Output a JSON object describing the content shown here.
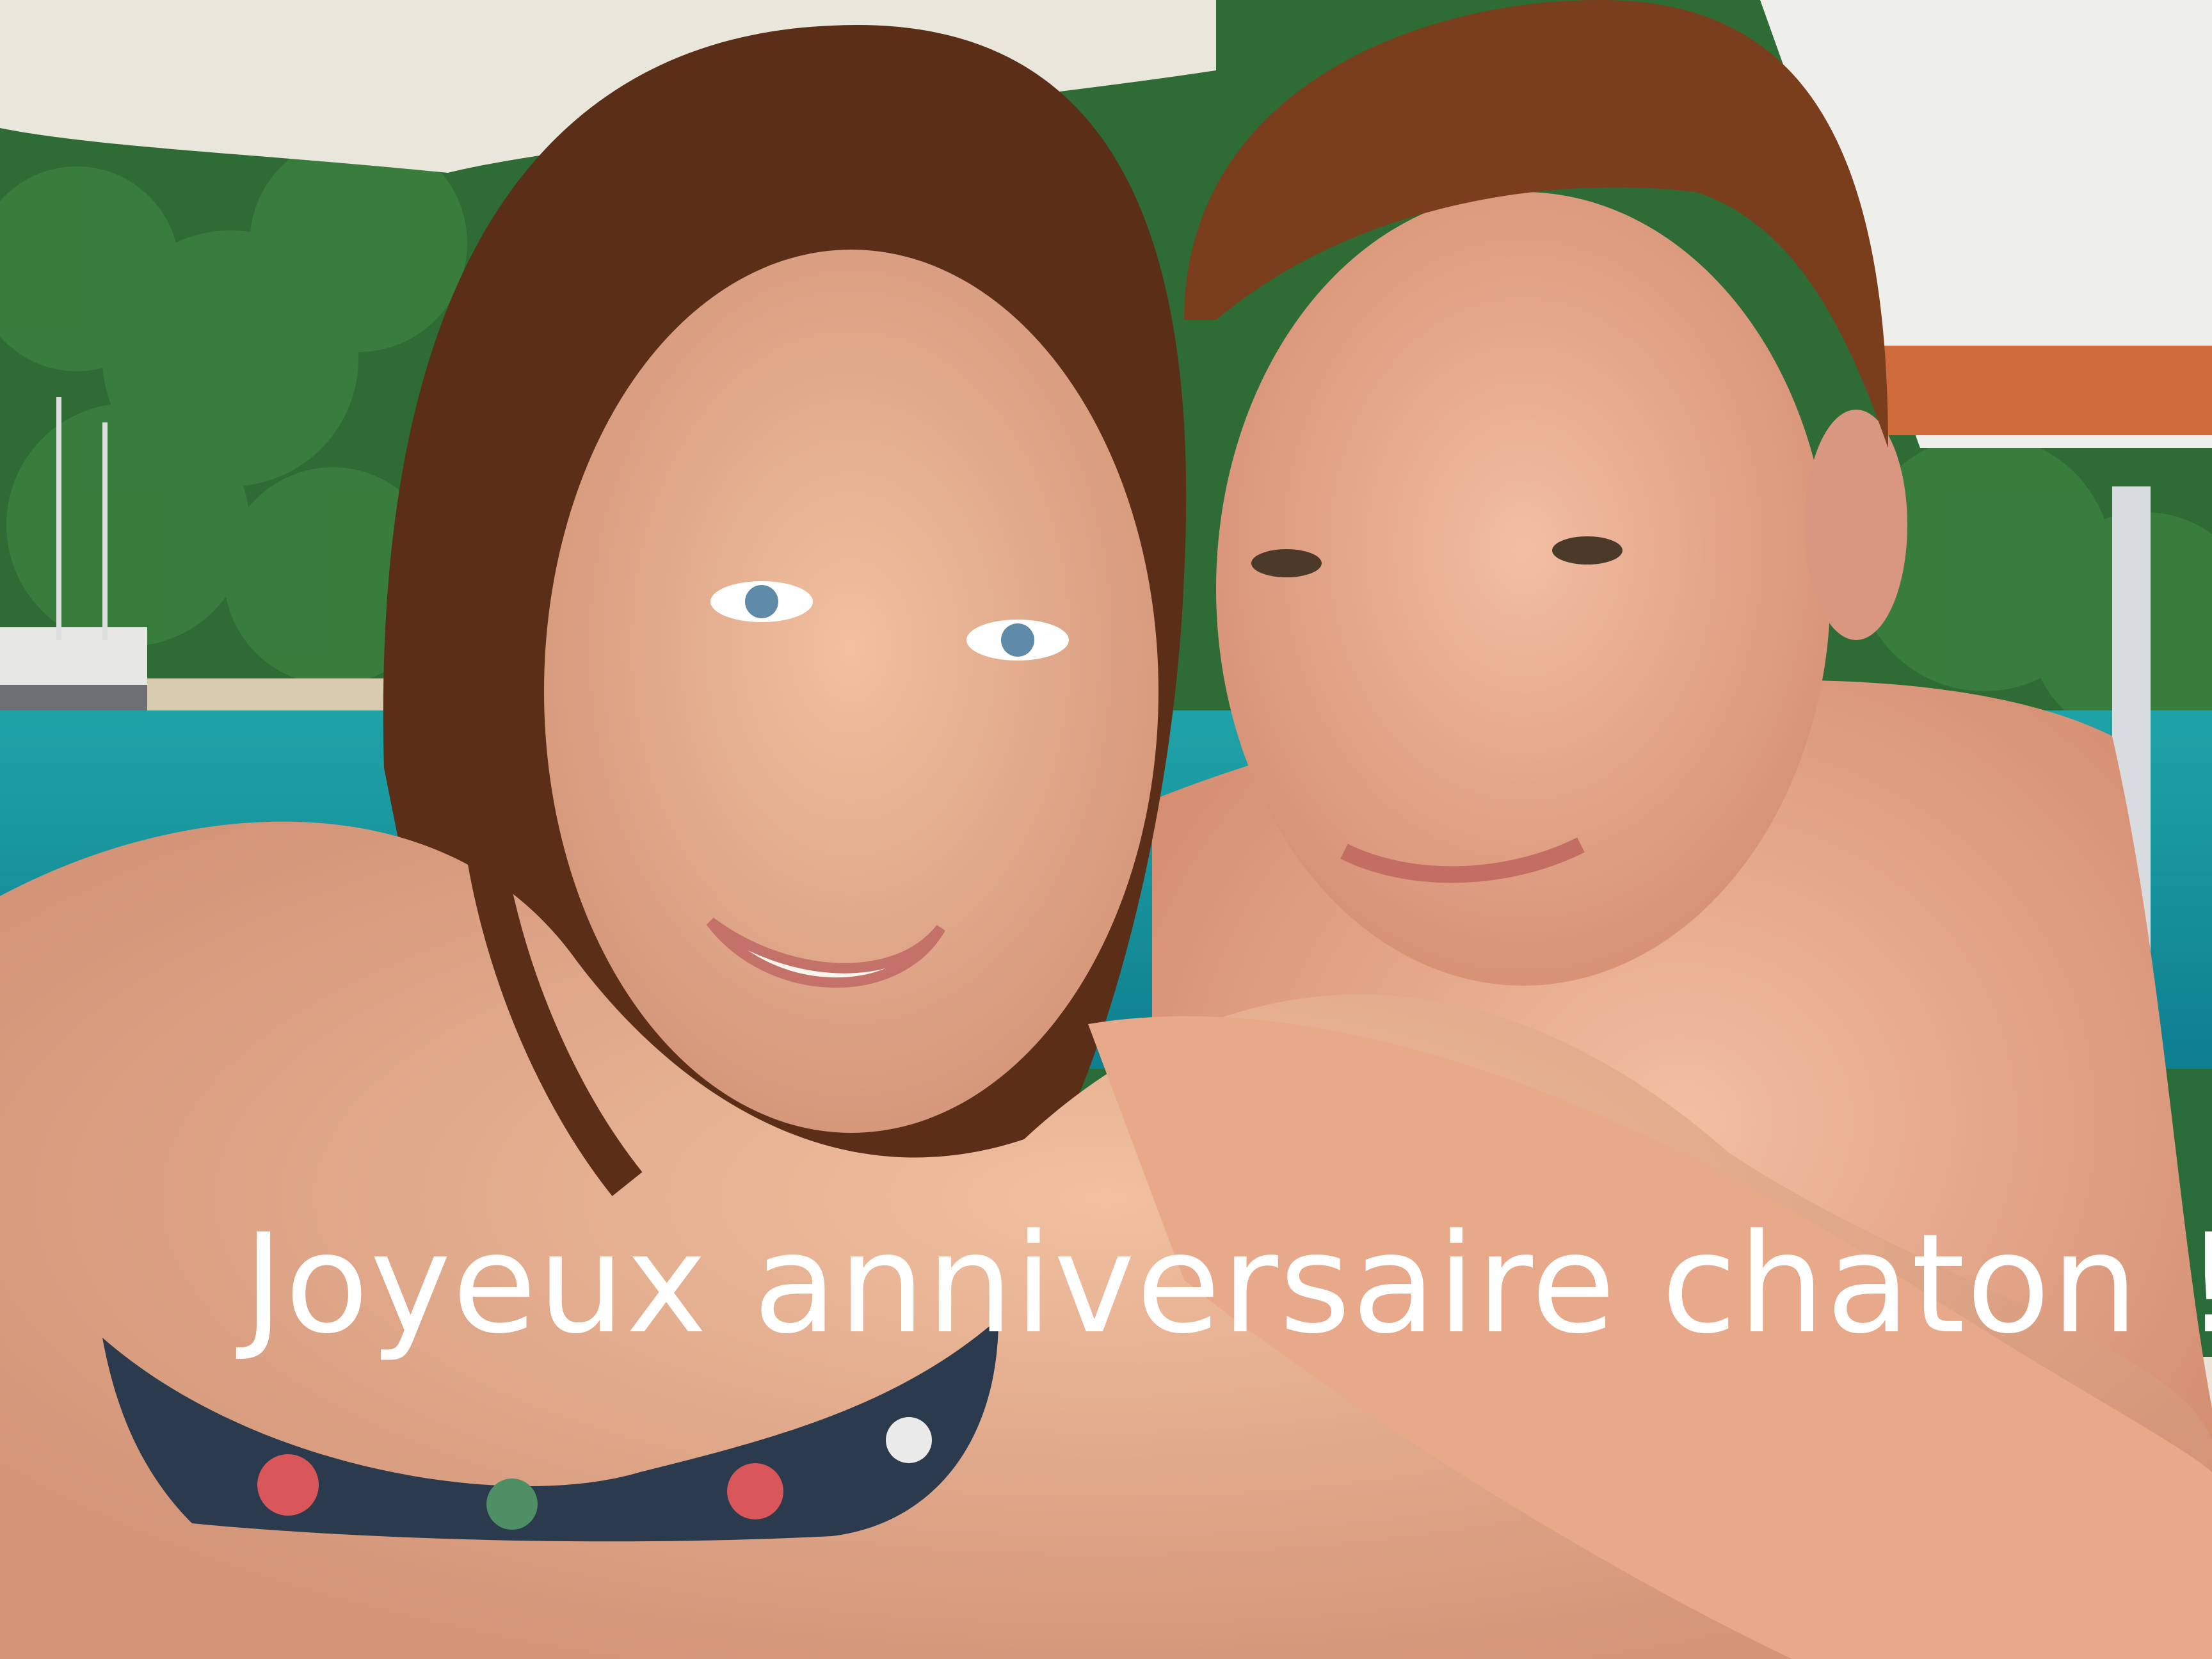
{
  "photo": {
    "caption": "Joyeux anniversaire chaton !"
  }
}
